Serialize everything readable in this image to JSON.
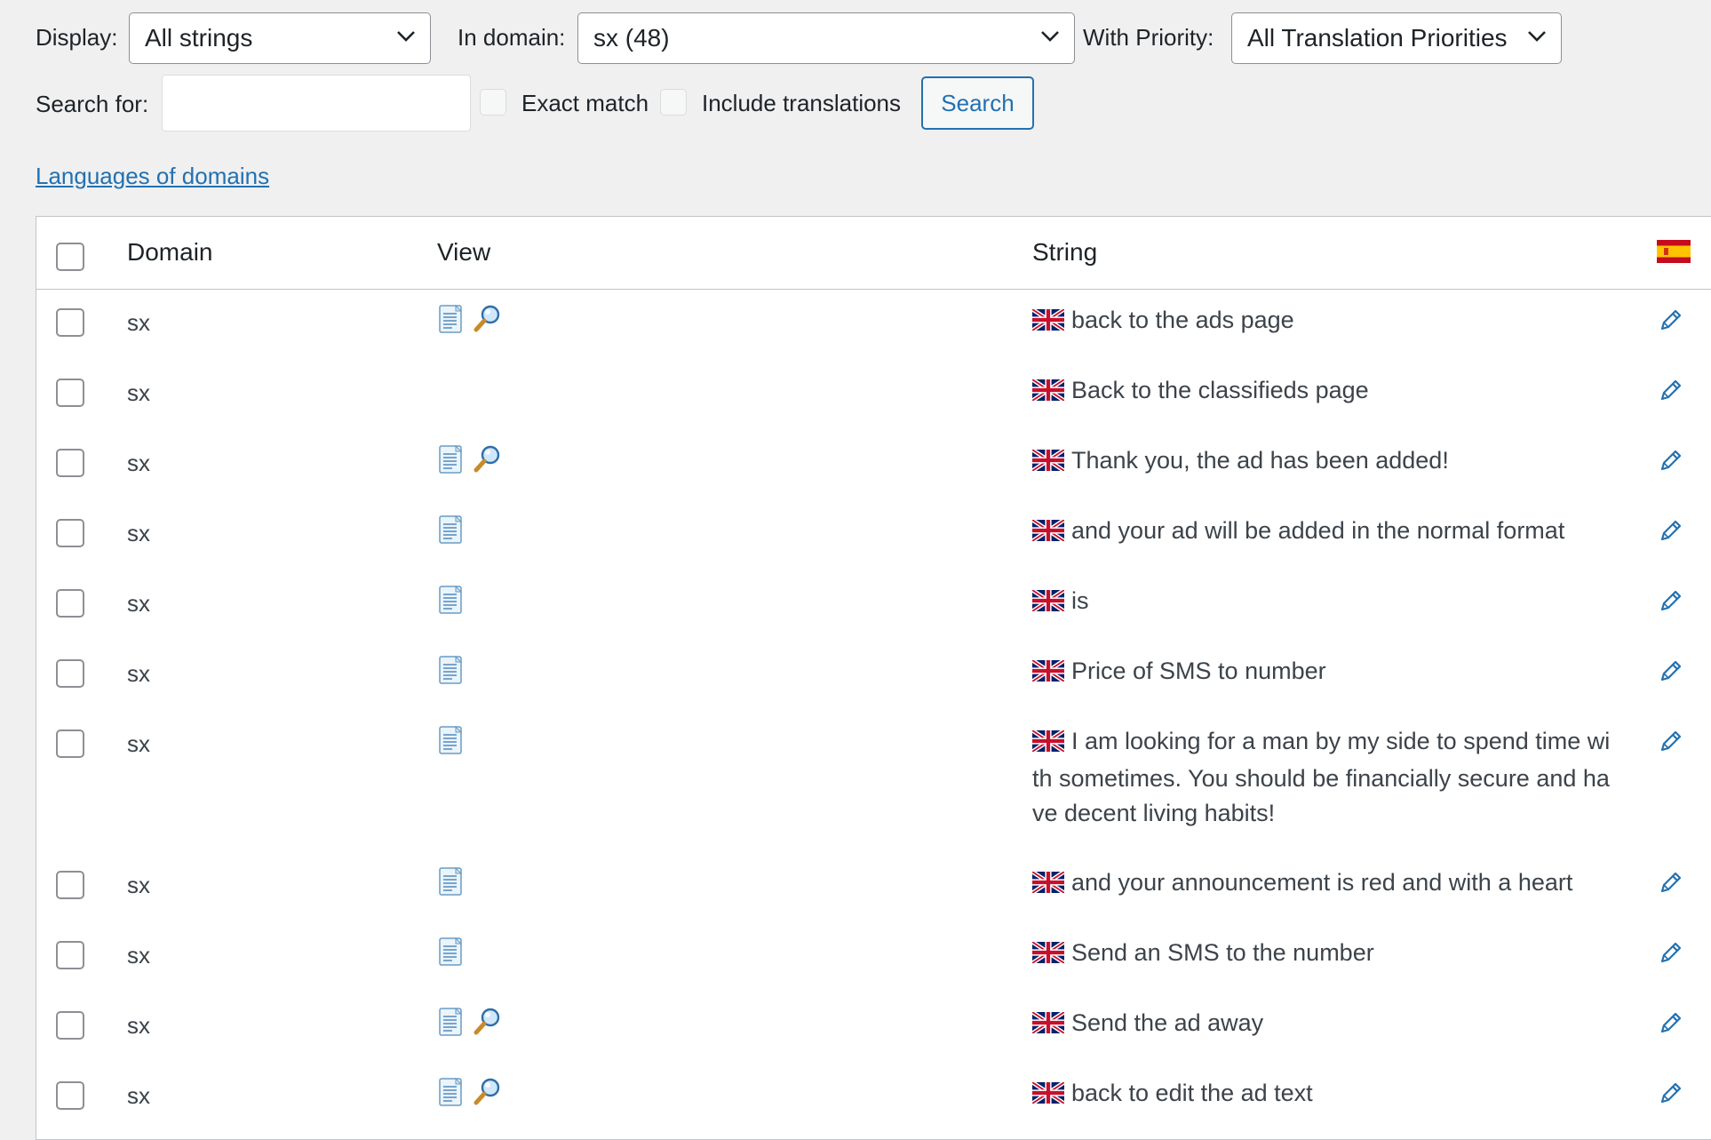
{
  "filters": {
    "display_label": "Display:",
    "display_value": "All strings",
    "domain_label": "In domain:",
    "domain_value": "sx (48)",
    "priority_label": "With Priority:",
    "priority_value": "All Translation Priorities",
    "search_label": "Search for:",
    "search_value": "",
    "exact_match_label": "Exact match",
    "include_translations_label": "Include translations",
    "search_button": "Search",
    "languages_link": "Languages of domains"
  },
  "table": {
    "headers": {
      "domain": "Domain",
      "view": "View",
      "string": "String"
    },
    "target_language_flag": "spain-flag-icon",
    "rows": [
      {
        "domain": "sx",
        "view": [
          "document-icon",
          "magnifier-icon"
        ],
        "string": "back to the ads page"
      },
      {
        "domain": "sx",
        "view": [],
        "string": "Back to the classifieds page"
      },
      {
        "domain": "sx",
        "view": [
          "document-icon",
          "magnifier-icon"
        ],
        "string": "Thank you, the ad has been added!"
      },
      {
        "domain": "sx",
        "view": [
          "document-icon"
        ],
        "string": "and your ad will be added in the normal format"
      },
      {
        "domain": "sx",
        "view": [
          "document-icon"
        ],
        "string": "is"
      },
      {
        "domain": "sx",
        "view": [
          "document-icon"
        ],
        "string": "Price of SMS to number"
      },
      {
        "domain": "sx",
        "view": [
          "document-icon"
        ],
        "string": "I am looking for a man by my side to spend time wi th sometimes. You should be financially secure and ha ve decent living habits!"
      },
      {
        "domain": "sx",
        "view": [
          "document-icon"
        ],
        "string": "and your announcement is red and with a heart"
      },
      {
        "domain": "sx",
        "view": [
          "document-icon"
        ],
        "string": "Send an SMS to the number"
      },
      {
        "domain": "sx",
        "view": [
          "document-icon",
          "magnifier-icon"
        ],
        "string": "Send the ad away"
      },
      {
        "domain": "sx",
        "view": [
          "document-icon",
          "magnifier-icon"
        ],
        "string": "back to edit the ad text"
      }
    ]
  },
  "colors": {
    "link": "#2271b1",
    "background": "#f0f0f1",
    "text": "#1d2327"
  }
}
